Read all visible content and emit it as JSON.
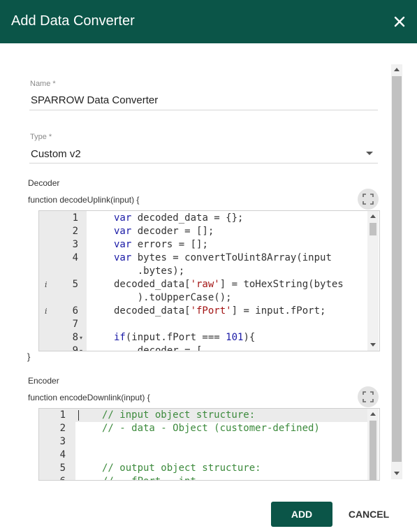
{
  "dialog": {
    "title": "Add Data Converter"
  },
  "name_field": {
    "label": "Name *",
    "value": "SPARROW Data Converter"
  },
  "type_field": {
    "label": "Type *",
    "value": "Custom v2"
  },
  "decoder": {
    "label": "Decoder",
    "function_signature": "function decodeUplink(input) {",
    "closing_brace": "}",
    "lines": [
      {
        "num": "1",
        "code": [
          {
            "t": "var",
            "c": "kw"
          },
          {
            "t": " decoded_data = {};"
          }
        ]
      },
      {
        "num": "2",
        "code": [
          {
            "t": "var",
            "c": "kw"
          },
          {
            "t": " decoder = [];"
          }
        ]
      },
      {
        "num": "3",
        "code": [
          {
            "t": "var",
            "c": "kw"
          },
          {
            "t": " errors = [];"
          }
        ]
      },
      {
        "num": "4",
        "code": [
          {
            "t": "var",
            "c": "kw"
          },
          {
            "t": " bytes = convertToUint8Array(input"
          }
        ]
      },
      {
        "num": "",
        "code": [
          {
            "t": "    .bytes);"
          }
        ]
      },
      {
        "num": "5",
        "info": "i",
        "code": [
          {
            "t": "decoded_data["
          },
          {
            "t": "'raw'",
            "c": "str"
          },
          {
            "t": "] = toHexString(bytes"
          }
        ]
      },
      {
        "num": "",
        "code": [
          {
            "t": "    ).toUpperCase();"
          }
        ]
      },
      {
        "num": "6",
        "info": "i",
        "code": [
          {
            "t": "decoded_data["
          },
          {
            "t": "'fPort'",
            "c": "str"
          },
          {
            "t": "] = input.fPort;"
          }
        ]
      },
      {
        "num": "7",
        "code": []
      },
      {
        "num": "8",
        "fold": "▾",
        "code": [
          {
            "t": "if",
            "c": "kw"
          },
          {
            "t": "(input.fPort === "
          },
          {
            "t": "101",
            "c": "num"
          },
          {
            "t": "){"
          }
        ]
      },
      {
        "num": "9",
        "fold": "▾",
        "code": [
          {
            "t": "    decoder = ["
          }
        ]
      }
    ]
  },
  "encoder": {
    "label": "Encoder",
    "function_signature": "function encodeDownlink(input) {",
    "lines": [
      {
        "num": "1",
        "code": [
          {
            "t": "// input object structure:",
            "c": "cmt"
          }
        ]
      },
      {
        "num": "2",
        "code": [
          {
            "t": "// - data - Object (customer-defined)",
            "c": "cmt"
          }
        ]
      },
      {
        "num": "3",
        "code": []
      },
      {
        "num": "4",
        "code": []
      },
      {
        "num": "5",
        "code": [
          {
            "t": "// output object structure:",
            "c": "cmt"
          }
        ]
      },
      {
        "num": "6",
        "code": [
          {
            "t": "// - fPort - int",
            "c": "cmt"
          }
        ]
      }
    ]
  },
  "actions": {
    "add": "ADD",
    "cancel": "CANCEL"
  },
  "colors": {
    "primary": "#0b5548",
    "keyword": "#1a1aa6",
    "string": "#a31515",
    "comment": "#3c8a3c"
  }
}
